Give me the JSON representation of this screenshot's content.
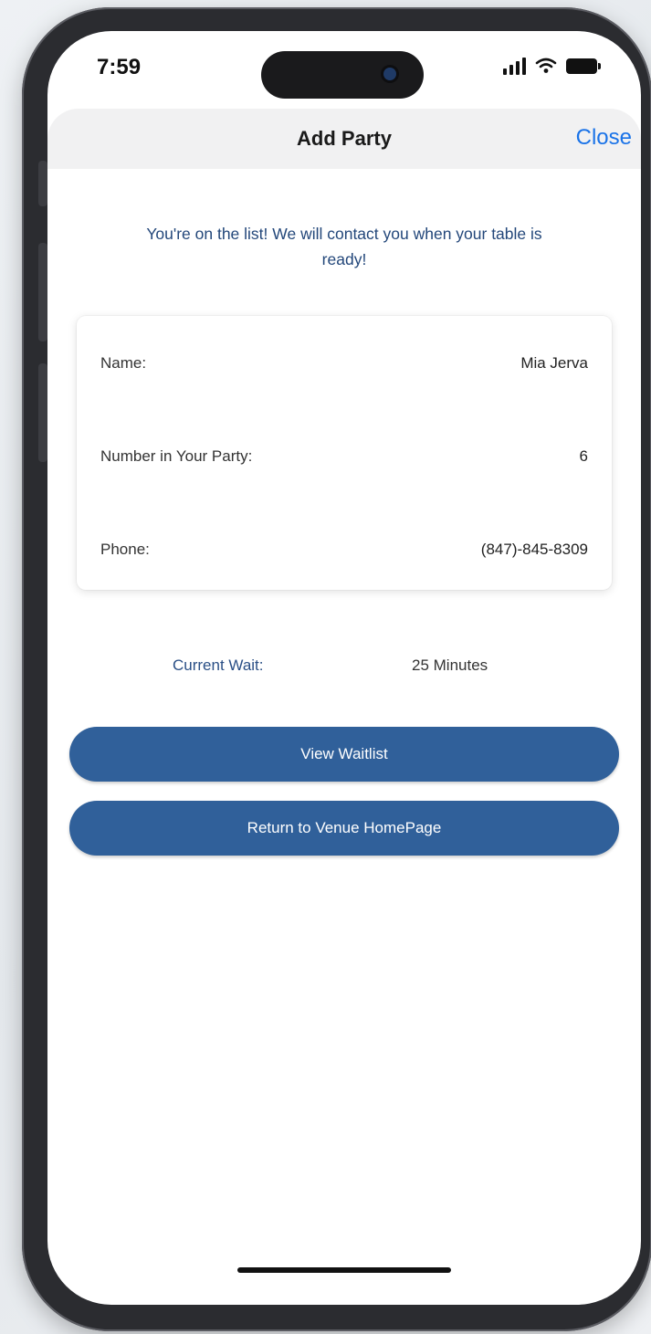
{
  "status_bar": {
    "time": "7:59",
    "icons": [
      "signal-icon",
      "wifi-icon",
      "battery-icon"
    ]
  },
  "nav": {
    "title": "Add Party",
    "close_label": "Close"
  },
  "message": "You're on the list! We will contact you when your table is ready!",
  "party": {
    "rows": [
      {
        "label": "Name:",
        "value": "Mia Jerva"
      },
      {
        "label": "Number in Your Party:",
        "value": "6"
      },
      {
        "label": "Phone:",
        "value": "(847)-845-8309"
      }
    ]
  },
  "wait": {
    "label": "Current Wait:",
    "value": "25 Minutes"
  },
  "buttons": {
    "view_waitlist": "View Waitlist",
    "return_home": "Return to Venue HomePage"
  },
  "colors": {
    "accent": "#30609a",
    "link": "#1a73e8",
    "message_text": "#23477a"
  }
}
